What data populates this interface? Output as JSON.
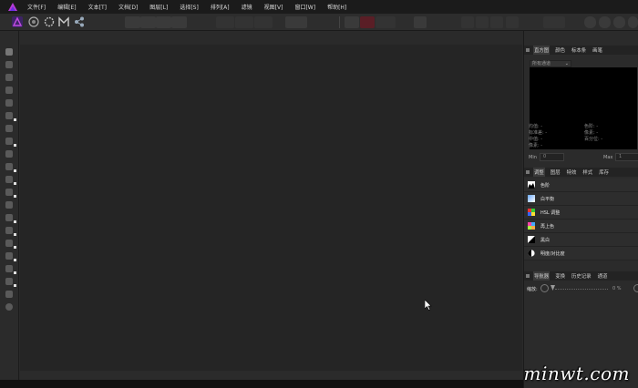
{
  "menu": [
    "文件[F]",
    "编辑[E]",
    "文本[T]",
    "文档[D]",
    "图层[L]",
    "选择[S]",
    "排列[A]",
    "滤镜",
    "视图[V]",
    "窗口[W]",
    "帮助[H]"
  ],
  "histogram_panel": {
    "tabs": [
      "直方图",
      "颜色",
      "标本条",
      "画笔"
    ],
    "channel_select": "所有通道",
    "stats_left": [
      "均值: -",
      "标准差: -",
      "中值: -",
      "像素: -"
    ],
    "stats_right": [
      "色阶: -",
      "像素: -",
      "百分位: -"
    ],
    "min_label": "Min",
    "min_value": "0",
    "max_label": "Max",
    "max_value": "1"
  },
  "adjustment_panel": {
    "tabs": [
      "调整",
      "图层",
      "特效",
      "样式",
      "库存"
    ],
    "items": [
      {
        "label": "色阶",
        "icon": "levels-icon"
      },
      {
        "label": "白平衡",
        "icon": "white-balance-icon"
      },
      {
        "label": "HSL 调整",
        "icon": "hsl-icon"
      },
      {
        "label": "再上色",
        "icon": "recolor-icon"
      },
      {
        "label": "黑白",
        "icon": "black-white-icon"
      },
      {
        "label": "明度/对比度",
        "icon": "brightness-contrast-icon"
      }
    ]
  },
  "navigator_panel": {
    "tabs": [
      "导航器",
      "变换",
      "历史记录",
      "通道"
    ],
    "zoom_label": "缩放:",
    "zoom_value": "0 %"
  },
  "watermark": "minwt.com",
  "colors": {
    "accent": "#8f2fe0",
    "background": "#252525"
  }
}
